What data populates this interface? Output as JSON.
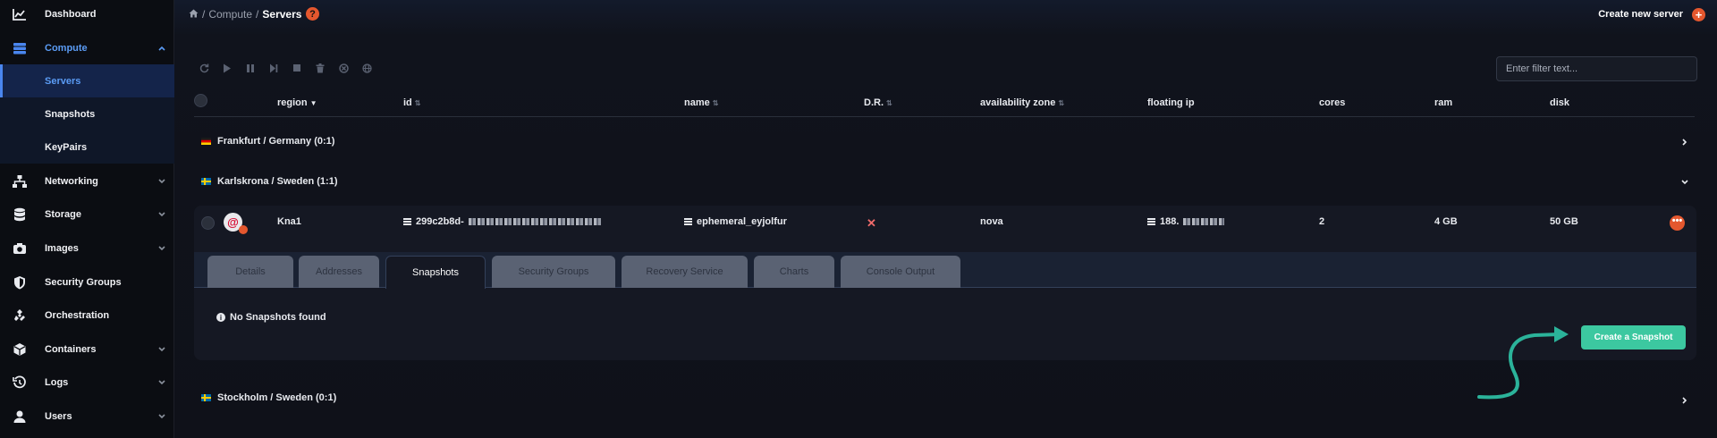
{
  "sidebar": {
    "items": [
      {
        "label": "Dashboard",
        "icon": "chart-icon"
      },
      {
        "label": "Compute",
        "icon": "server-stack-icon"
      },
      {
        "label": "Servers"
      },
      {
        "label": "Snapshots"
      },
      {
        "label": "KeyPairs"
      },
      {
        "label": "Networking",
        "icon": "network-icon"
      },
      {
        "label": "Storage",
        "icon": "database-icon"
      },
      {
        "label": "Images",
        "icon": "camera-icon"
      },
      {
        "label": "Security Groups",
        "icon": "shield-icon"
      },
      {
        "label": "Orchestration",
        "icon": "orchestration-icon"
      },
      {
        "label": "Containers",
        "icon": "box-icon"
      },
      {
        "label": "Logs",
        "icon": "history-icon"
      },
      {
        "label": "Users",
        "icon": "user-icon"
      }
    ]
  },
  "header": {
    "breadcrumb": {
      "sep": "/",
      "section": "Compute",
      "current": "Servers"
    },
    "help": "?",
    "create_label": "Create new server",
    "create_icon": "+"
  },
  "filter": {
    "placeholder": "Enter filter text..."
  },
  "columns": [
    "region",
    "id",
    "name",
    "D.R.",
    "availability zone",
    "floating ip",
    "cores",
    "ram",
    "disk"
  ],
  "groups": [
    {
      "label": "Frankfurt / Germany (0:1)"
    },
    {
      "label": "Karlskrona / Sweden (1:1)"
    },
    {
      "label": "Stockholm / Sweden (0:1)"
    }
  ],
  "server": {
    "region": "Kna1",
    "id": "299c2b8d-",
    "name": "ephemeral_eyjolfur",
    "dr": "✕",
    "zone": "nova",
    "floating_ip": "188.",
    "cores": "2",
    "ram": "4 GB",
    "disk": "50 GB",
    "menu": "•••"
  },
  "tabs": [
    "Details",
    "Addresses",
    "Snapshots",
    "Security Groups",
    "Recovery Service",
    "Charts",
    "Console Output"
  ],
  "selected_tab": "Snapshots",
  "snapshots": {
    "empty_text": "No Snapshots found",
    "create_label": "Create a Snapshot"
  },
  "colors": {
    "accent": "#4a86ef",
    "danger": "#e4572e",
    "success": "#3cc8a0",
    "annotation_arrow": "#2bb39a"
  }
}
